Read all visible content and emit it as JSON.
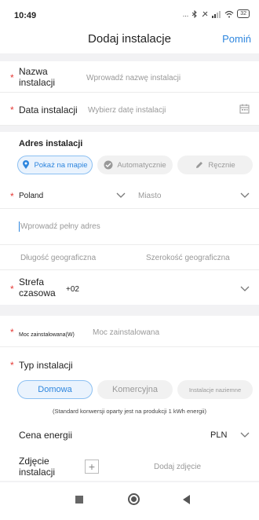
{
  "status_bar": {
    "time": "10:49",
    "dots": "...",
    "battery": "32"
  },
  "header": {
    "title": "Dodaj instalacje",
    "skip": "Pomiń"
  },
  "form": {
    "name": {
      "label": "Nazwa\ninstalacji",
      "placeholder": "Wprowadź nazwę instalacji"
    },
    "date": {
      "label": "Data instalacji",
      "placeholder": "Wybierz datę instalacji"
    },
    "address": {
      "section_title": "Adres instalacji",
      "modes": [
        "Pokaż na mapie",
        "Automatycznie",
        "Ręcznie"
      ],
      "selected_mode": "Pokaż na mapie",
      "country": "Poland",
      "city_placeholder": "Miasto",
      "full_address_placeholder": "Wprowadź pełny adres",
      "longitude_placeholder": "Długość geograficzna",
      "latitude_placeholder": "Szerokość geograficzna"
    },
    "timezone": {
      "label": "Strefa\nczasowa",
      "value": "+02"
    },
    "power": {
      "label": "Moc zainstalowana(W)",
      "placeholder": "Moc zainstalowana"
    },
    "type": {
      "label": "Typ instalacji",
      "options": [
        "Domowa",
        "Komercyjna",
        "Instalacje naziemne"
      ],
      "selected": "Domowa",
      "note": "(Standard konwersji oparty jest na produkcji 1 kWh energii)"
    },
    "energy_price": {
      "label": "Cena energii",
      "currency": "PLN"
    },
    "photo": {
      "label": "Zdjęcie\ninstalacji",
      "add_label": "Dodaj zdjęcie"
    }
  },
  "colors": {
    "accent": "#2e86de",
    "required": "#e53935",
    "separator": "#f2f2f4"
  },
  "icons": [
    "wifi-icon",
    "signal-icon",
    "bluetooth-icon",
    "calendar-icon",
    "location-pin-icon",
    "check-circle-icon",
    "pencil-icon",
    "chevron-down-icon",
    "plus-icon"
  ]
}
